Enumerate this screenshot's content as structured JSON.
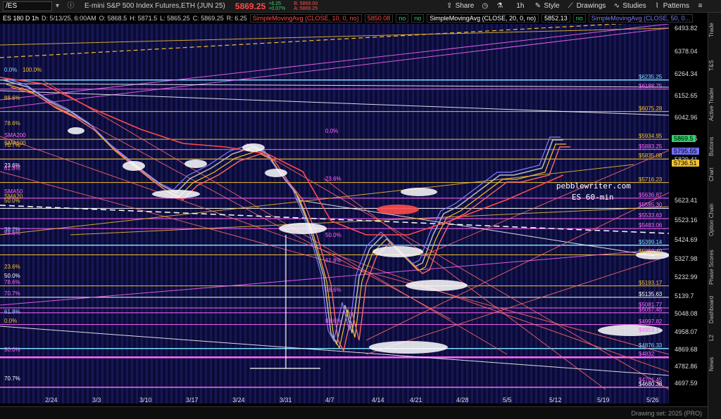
{
  "toolbar": {
    "symbol": "/ES",
    "title": "E-mini S&P 500 Index Futures,ETH (JUN 25)",
    "price": "5869.25",
    "change_top": "+6.25",
    "change_bottom": "+0.07%",
    "bid": "B: 5869.00",
    "ask": "A: 5869.25",
    "share_label": "Share",
    "timeframe": "1h",
    "style_label": "Style",
    "drawings_label": "Drawings",
    "studies_label": "Studies",
    "patterns_label": "Patterns"
  },
  "infoline": {
    "label": "ES 180 D 1h",
    "date": "D: 5/13/25, 6:00AM",
    "open": "O: 5868.5",
    "high": "H: 5871.5",
    "low": "L: 5865.25",
    "close": "C: 5869.25",
    "range": "R: 6.25",
    "sma10": "SimpleMovingAvg (CLOSE, 10, 0, no)",
    "sma10_val": "5850.08",
    "sma20": "SimpleMovingAvg (CLOSE, 20, 0, no)",
    "sma20_val": "5852.13",
    "sma50": "SimpleMovingAvg (CLOSE, 50, 0...",
    "no": "no"
  },
  "axis": {
    "ticks": [
      "6493.82",
      "6378.04",
      "6264.34",
      "6152.65",
      "6042.96",
      "5935.25",
      "5829.41",
      "5623.41",
      "5523.16",
      "5424.69",
      "5327.98",
      "5232.99",
      "5139.7",
      "5048.08",
      "4958.07",
      "4869.68",
      "4782.86",
      "4697.59"
    ],
    "badges": [
      {
        "text": "5869.5",
        "color": "#2fd36b"
      },
      {
        "text": "5795.55",
        "color": "#6f6fff"
      },
      {
        "text": "5736.51",
        "color": "#f2c12e"
      }
    ]
  },
  "levels": [
    {
      "text": "$6235.25",
      "color": "#7fdcff"
    },
    {
      "text": "$6188.75",
      "color": "#ff66ff"
    },
    {
      "text": "$6075.28",
      "color": "#f2c12e"
    },
    {
      "text": "$5934.95",
      "color": "#f2c12e"
    },
    {
      "text": "$5883.25",
      "color": "#ff66ff"
    },
    {
      "text": "$5835.08",
      "color": "#f2c12e"
    },
    {
      "text": "$5716.23",
      "color": "#f2c12e"
    },
    {
      "text": "$5636.87",
      "color": "#ff66ff"
    },
    {
      "text": "$5585.30",
      "color": "#ff66ff"
    },
    {
      "text": "$5533.63",
      "color": "#ff66ff"
    },
    {
      "text": "$5483.06",
      "color": "#ff66ff"
    },
    {
      "text": "$5399.14",
      "color": "#7fdcff"
    },
    {
      "text": "$5350.40",
      "color": "#f2c12e"
    },
    {
      "text": "$5193.17",
      "color": "#f2c12e"
    },
    {
      "text": "$5135.63",
      "color": "#ffffff"
    },
    {
      "text": "$5081.77",
      "color": "#ff66ff"
    },
    {
      "text": "$5057.45",
      "color": "#ff66ff"
    },
    {
      "text": "$4997.82",
      "color": "#ff66ff"
    },
    {
      "text": "$4953.1",
      "color": "#ff66ff"
    },
    {
      "text": "$4876.33",
      "color": "#7fdcff"
    },
    {
      "text": "$4832",
      "color": "#ff66ff"
    },
    {
      "text": "$4701.45",
      "color": "#ff66ff"
    },
    {
      "text": "$4680.38",
      "color": "#ffffff"
    }
  ],
  "fib_left": [
    {
      "text": "0.0%",
      "color": "#7fdcff"
    },
    {
      "text": "100.0%",
      "color": "#f2c12e"
    },
    {
      "text": "88.6%",
      "color": "#f2c12e"
    },
    {
      "text": "78.6%",
      "color": "#f2c12e"
    },
    {
      "text": "SMA200",
      "color": "#ff66ff"
    },
    {
      "text": "SMA100",
      "color": "#f2c12e"
    },
    {
      "text": "70.7%",
      "color": "#f2c12e"
    },
    {
      "text": "23.6%",
      "color": "#ffffff"
    },
    {
      "text": "61.8%",
      "color": "#ff66ff"
    },
    {
      "text": "SMA50",
      "color": "#ff66ff"
    },
    {
      "text": "SMA20",
      "color": "#f2c12e"
    },
    {
      "text": "50.0%",
      "color": "#f2c12e"
    },
    {
      "text": "38.2%",
      "color": "#7fdcff"
    },
    {
      "text": "88.6%",
      "color": "#ff66ff"
    },
    {
      "text": "23.6%",
      "color": "#f2c12e"
    },
    {
      "text": "50.0%",
      "color": "#ffffff"
    },
    {
      "text": "78.6%",
      "color": "#ff66ff"
    },
    {
      "text": "70.7%",
      "color": "#ff66ff"
    },
    {
      "text": "61.8%",
      "color": "#7fdcff"
    },
    {
      "text": "0.0%",
      "color": "#f2c12e"
    },
    {
      "text": "50.0%",
      "color": "#ff66ff"
    },
    {
      "text": "70.7%",
      "color": "#ffffff"
    }
  ],
  "mid_labels": [
    {
      "text": "0.0%",
      "color": "#ff66ff"
    },
    {
      "text": "23.6%",
      "color": "#ff66ff"
    },
    {
      "text": "50.0%",
      "color": "#ff66ff"
    },
    {
      "text": "61.8%",
      "color": "#ff66ff"
    },
    {
      "text": "78.6%",
      "color": "#ff66ff"
    },
    {
      "text": "88.6%",
      "color": "#ff66ff"
    }
  ],
  "watermark": {
    "line1": "pebblewriter.com",
    "line2": "ES 60-min"
  },
  "dates": [
    "2/24",
    "3/3",
    "3/10",
    "3/17",
    "3/24",
    "3/31",
    "4/7",
    "4/14",
    "4/21",
    "4/28",
    "5/5",
    "5/12",
    "5/19",
    "5/26"
  ],
  "rail": [
    "Trade",
    "T&S",
    "Active Trader",
    "Buttons",
    "Chart",
    "Option Chain",
    "Phase Scores",
    "Dashboard",
    "L2",
    "News"
  ],
  "footer": {
    "note": "Drawing set: 2025 (PRO)"
  }
}
